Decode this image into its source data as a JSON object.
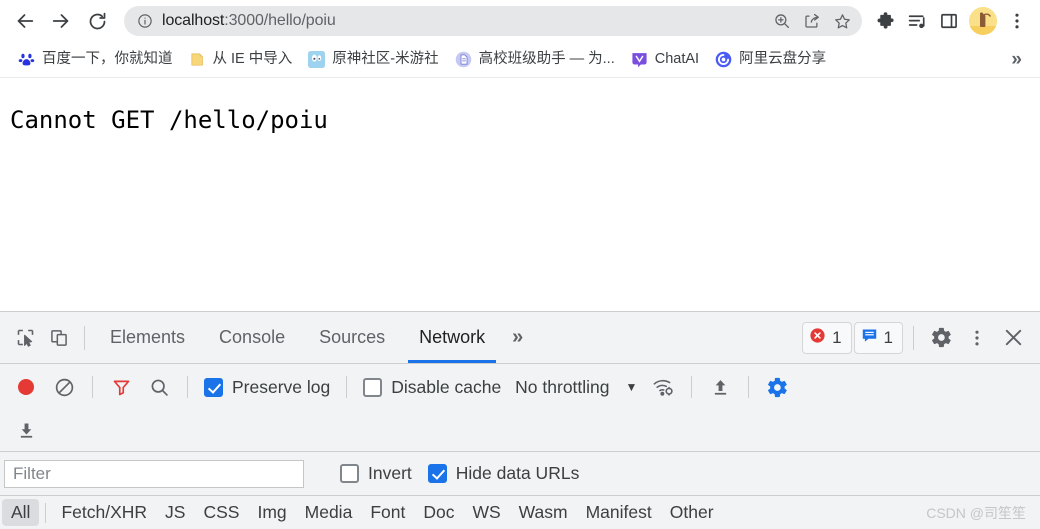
{
  "browser": {
    "nav": {
      "back_label": "Back",
      "forward_label": "Forward",
      "reload_label": "Reload"
    },
    "omnibox": {
      "info_icon": "info-circle-icon",
      "host": "localhost",
      "path": ":3000/hello/poiu",
      "full_url": "localhost:3000/hello/poiu",
      "actions": [
        {
          "name": "zoom-icon",
          "label": "Zoom"
        },
        {
          "name": "share-icon",
          "label": "Share this page"
        },
        {
          "name": "bookmark-star-icon",
          "label": "Bookmark this tab"
        }
      ]
    },
    "toolbar_icons": [
      {
        "name": "extensions-puzzle-icon",
        "label": "Extensions"
      },
      {
        "name": "media-playlist-icon",
        "label": "Media controls"
      },
      {
        "name": "side-panel-icon",
        "label": "Side panel"
      }
    ],
    "avatar_label": "Profile",
    "menu_label": "Customize and control Google Chrome"
  },
  "bookmarks": {
    "items": [
      {
        "label": "百度一下，你就知道",
        "favicon": "baidu-paw-icon",
        "color": "#2932e1"
      },
      {
        "label": "从 IE 中导入",
        "favicon": "folder-icon",
        "color": "#f5c242"
      },
      {
        "label": "原神社区-米游社",
        "favicon": "mihoyo-icon",
        "color": "#4e9bd6"
      },
      {
        "label": "高校班级助手 — 为...",
        "favicon": "doc-icon",
        "color": "#8d8ee8"
      },
      {
        "label": "ChatAI",
        "favicon": "chatai-icon",
        "color": "#7a4fe0"
      },
      {
        "label": "阿里云盘分享",
        "favicon": "aliyun-drive-icon",
        "color": "#4a5cf5"
      }
    ],
    "overflow_label": "»"
  },
  "page": {
    "message": "Cannot GET /hello/poiu"
  },
  "devtools": {
    "tools": [
      {
        "name": "inspect-element-icon",
        "label": "Inspect element"
      },
      {
        "name": "device-toolbar-icon",
        "label": "Toggle device toolbar"
      }
    ],
    "tabs": [
      {
        "label": "Elements",
        "active": false
      },
      {
        "label": "Console",
        "active": false
      },
      {
        "label": "Sources",
        "active": false
      },
      {
        "label": "Network",
        "active": true
      }
    ],
    "tabs_overflow_label": "»",
    "badges": {
      "errors": {
        "icon": "error-circle-icon",
        "count": "1",
        "color": "#e53935"
      },
      "messages": {
        "icon": "message-icon",
        "count": "1",
        "color": "#1a73e8"
      }
    },
    "settings_label": "Settings",
    "more_label": "More options",
    "close_label": "Close DevTools",
    "network_toolbar": {
      "record_label": "Stop recording network log",
      "record_active": true,
      "clear_label": "Clear network log",
      "filter_icon_label": "Filter",
      "filter_icon_active": true,
      "search_label": "Search",
      "preserve_log": {
        "label": "Preserve log",
        "checked": true
      },
      "disable_cache": {
        "label": "Disable cache",
        "checked": false
      },
      "throttling": {
        "value": "No throttling",
        "caret": "▼"
      },
      "network_conditions_label": "Network conditions",
      "import_label": "Import HAR file",
      "export_label": "Export HAR file",
      "capture_settings_label": "Network settings"
    },
    "filter_row": {
      "filter_placeholder": "Filter",
      "filter_value": "",
      "invert": {
        "label": "Invert",
        "checked": false
      },
      "hide_data_urls": {
        "label": "Hide data URLs",
        "checked": true
      }
    },
    "resource_types": [
      {
        "label": "All",
        "active": true
      },
      {
        "label": "Fetch/XHR",
        "active": false
      },
      {
        "label": "JS",
        "active": false
      },
      {
        "label": "CSS",
        "active": false
      },
      {
        "label": "Img",
        "active": false
      },
      {
        "label": "Media",
        "active": false
      },
      {
        "label": "Font",
        "active": false
      },
      {
        "label": "Doc",
        "active": false
      },
      {
        "label": "WS",
        "active": false
      },
      {
        "label": "Wasm",
        "active": false
      },
      {
        "label": "Manifest",
        "active": false
      },
      {
        "label": "Other",
        "active": false
      }
    ]
  },
  "watermark": "CSDN @司笙笙"
}
